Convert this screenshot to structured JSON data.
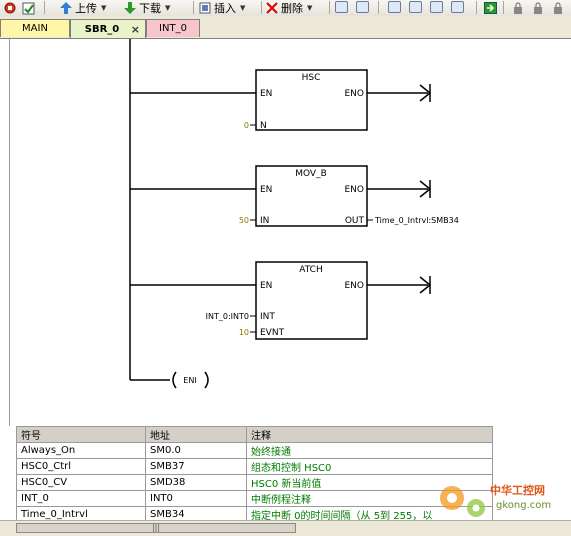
{
  "toolbar": {
    "upload_label": "上传",
    "download_label": "下载",
    "insert_label": "插入",
    "delete_label": "删除"
  },
  "tabs": [
    {
      "label": "MAIN",
      "color": "#fff6a8"
    },
    {
      "label": "SBR_0",
      "color": "#e8f4c8",
      "close": "×"
    },
    {
      "label": "INT_0",
      "color": "#f6c6cc"
    }
  ],
  "ladder": {
    "hsc": {
      "title": "HSC",
      "en": "EN",
      "eno": "ENO",
      "pin_n": "N",
      "n_value": "0"
    },
    "movb": {
      "title": "MOV_B",
      "en": "EN",
      "eno": "ENO",
      "pin_in": "IN",
      "pin_out": "OUT",
      "in_value": "50",
      "out_value": "Time_0_Intrvl:SMB34"
    },
    "atch": {
      "title": "ATCH",
      "en": "EN",
      "eno": "ENO",
      "pin_int": "INT",
      "pin_evnt": "EVNT",
      "int_value": "INT_0:INT0",
      "evnt_value": "10"
    },
    "eni": "ENI"
  },
  "symbol_table": {
    "headers": [
      "符号",
      "地址",
      "注释"
    ],
    "rows": [
      {
        "symbol": "Always_On",
        "address": "SM0.0",
        "comment": "始终接通"
      },
      {
        "symbol": "HSC0_Ctrl",
        "address": "SMB37",
        "comment": "组态和控制 HSC0"
      },
      {
        "symbol": "HSC0_CV",
        "address": "SMD38",
        "comment": "HSC0 新当前值"
      },
      {
        "symbol": "INT_0",
        "address": "INT0",
        "comment": "中断例程注释"
      },
      {
        "symbol": "Time_0_Intrvl",
        "address": "SMB34",
        "comment": "指定中断 0的时间间隔（从 5到 255，以"
      }
    ]
  },
  "scrollbar": {
    "grip": "|||"
  },
  "watermark": {
    "text1": "中华工控网",
    "text2": "gkong.com"
  }
}
